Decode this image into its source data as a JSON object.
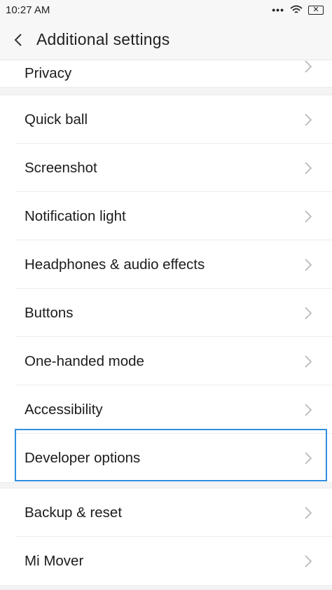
{
  "status_bar": {
    "time": "10:27 AM",
    "dots": "•••",
    "wifi_icon": "wifi-icon",
    "battery_icon": "battery-icon",
    "battery_text": "✕"
  },
  "header": {
    "back_icon": "back-arrow-icon",
    "title": "Additional settings"
  },
  "items": [
    {
      "label": "Privacy"
    },
    {
      "label": "Quick ball"
    },
    {
      "label": "Screenshot"
    },
    {
      "label": "Notification light"
    },
    {
      "label": "Headphones & audio effects"
    },
    {
      "label": "Buttons"
    },
    {
      "label": "One-handed mode"
    },
    {
      "label": "Accessibility"
    },
    {
      "label": "Developer options"
    },
    {
      "label": "Backup & reset"
    },
    {
      "label": "Mi Mover"
    }
  ],
  "highlight_color": "#2f8fe0"
}
